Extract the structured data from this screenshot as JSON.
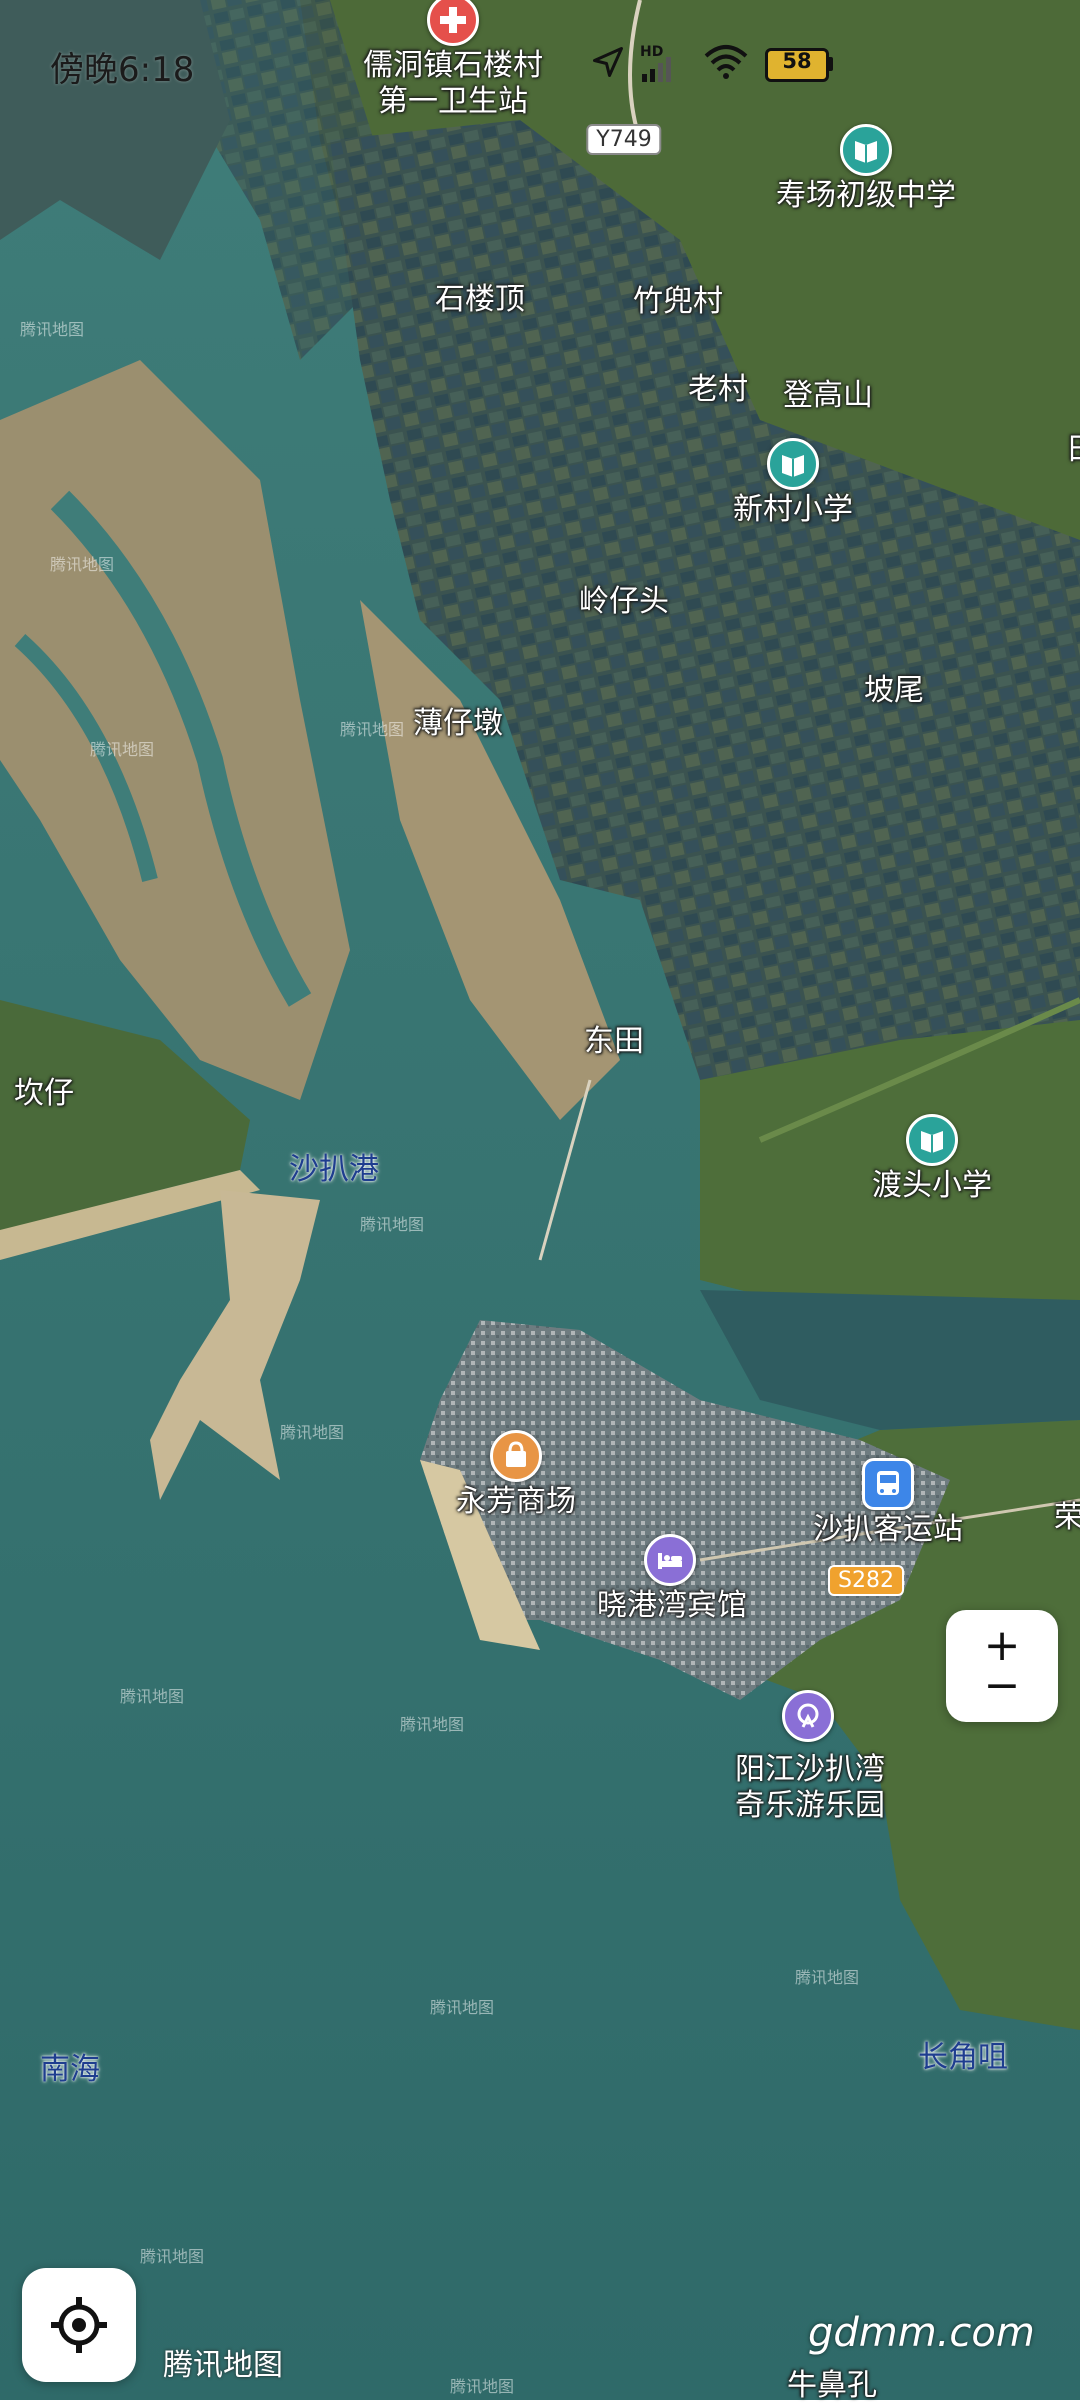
{
  "status_bar": {
    "time": "傍晚6:18",
    "battery": "58",
    "network": "HD"
  },
  "roads": {
    "y749": "Y749",
    "s282": "S282"
  },
  "places": {
    "clinic": "儒洞镇石楼村\n第一卫生站",
    "shouchang_school": "寿场初级中学",
    "shiloud": "石楼顶",
    "zhudou": "竹兜村",
    "laocun": "老村",
    "denggaoshan": "登高山",
    "xincun_school": "新村小学",
    "lingzaitou": "岭仔头",
    "powei": "坡尾",
    "bozaidun": "薄仔墩",
    "dongtian": "东田",
    "kanzai": "坎仔",
    "shabagang": "沙扒港",
    "dutou_school": "渡头小学",
    "yongfang_mall": "永芳商场",
    "shaba_station": "沙扒客运站",
    "xiaogang_hotel": "晓港湾宾馆",
    "amusement_park": "阳江沙扒湾\n奇乐游乐园",
    "nanhai": "南海",
    "changjiaoju": "长角咀",
    "niubikong": "牛鼻孔",
    "edge_rong": "荣",
    "edge_top": "田"
  },
  "map_watermark": "腾讯地图",
  "logo_text": "腾讯地图",
  "site_watermark": "gdmm.com",
  "zoom": {
    "in": "+",
    "out": "−"
  },
  "colors": {
    "water": "#3d7a78",
    "land": "#4f6b3a",
    "sand": "#a89572",
    "poi_health": "#e5504b",
    "poi_school": "#2aa39a",
    "poi_shop": "#e89545",
    "poi_hotel": "#8a6fd6",
    "poi_transit": "#3d86e8"
  }
}
